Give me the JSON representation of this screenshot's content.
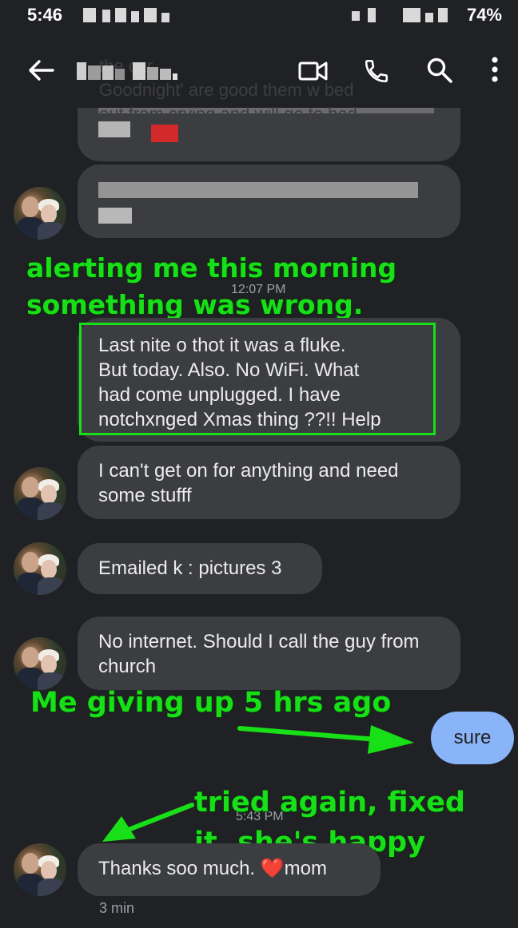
{
  "status_bar": {
    "time": "5:46",
    "battery": "74%"
  },
  "app_bar": {
    "obscured_text": [
      "the car.",
      "Goodnight' are good them w bed",
      "out from crying and will go to bed"
    ]
  },
  "messages": [
    {
      "text": "I can't get on for anything and need some stufff"
    },
    {
      "text": "Emailed k : pictures 3"
    },
    {
      "text": "No internet.   Should I call the guy from church"
    },
    {
      "text": "Thanks soo much.  ❤️mom"
    }
  ],
  "highlighted_message": {
    "lines": [
      "Last nite o thot it was a fluke.",
      "But today.  Also.  No WiFi.   What",
      "had come unplugged.  I have",
      "notchxnged Xmas thing ??!!  Help"
    ]
  },
  "sent_message": {
    "text": "sure"
  },
  "timestamps": {
    "t1": "12:07 PM",
    "t2": "5:43 PM",
    "last_status": "3 min"
  },
  "annotations": {
    "top": [
      "alerting me this morning",
      "something was wrong."
    ],
    "middle": "Me giving up 5 hrs ago",
    "bottom": [
      "tried again, fixed",
      "it, she's happy"
    ]
  },
  "colors": {
    "background": "#202124",
    "received_bubble": "#3c3d41",
    "sent_bubble": "#8ab4f8",
    "annotation_green": "#18e018"
  }
}
